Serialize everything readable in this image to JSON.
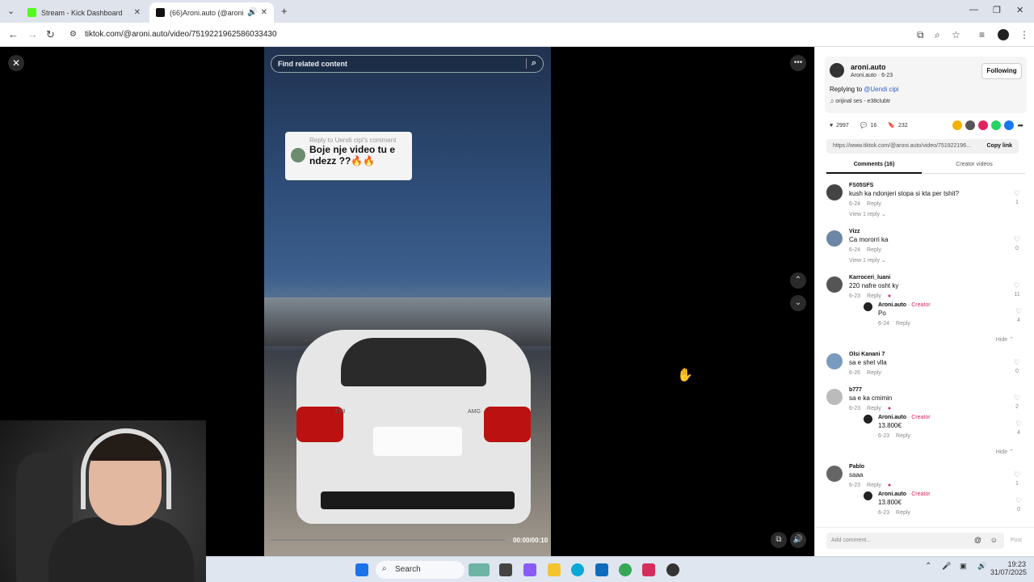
{
  "browser": {
    "tabs": [
      {
        "title": "Stream - Kick Dashboard",
        "favicon_color": "#53fc18"
      },
      {
        "title": "(66)Aroni.auto (@aroni.auto",
        "favicon_color": "#111111"
      }
    ],
    "url": "tiktok.com/@aroni.auto/video/7519221962586033430"
  },
  "video": {
    "search_placeholder": "Find related content",
    "reply_bubble": {
      "header": "Reply to Uendi cipi's comment",
      "text": "Boje nje video tu e ndezz ??🔥🔥"
    },
    "time": "00:00/00:10",
    "progress": 0.0,
    "close_icon": "✕",
    "more_icon": "•••"
  },
  "author": {
    "handle": "aroni.auto",
    "name_date": "Aroni.auto · 6-23",
    "follow_label": "Following",
    "replying_prefix": "Replying to",
    "replying_to": "@Uendi cipi",
    "sound": "orijinal ses - e38clubtr"
  },
  "stats": {
    "likes": "2997",
    "comments": "16",
    "saves": "232"
  },
  "share": {
    "url": "https://www.tiktok.com/@aroni.auto/video/751922196...",
    "copy_label": "Copy link"
  },
  "tabs": {
    "comments": "Comments (16)",
    "creator": "Creator videos"
  },
  "comments": [
    {
      "user": "FS05SFS",
      "text": "kush ka ndonjeri stopa si kta per tshit?",
      "date": "6-24",
      "reply": "Reply",
      "likes": "1",
      "view": "View 1 reply ⌄"
    },
    {
      "user": "Vizz",
      "text": "Ca mororri ka",
      "date": "6-24",
      "reply": "Reply",
      "likes": "0",
      "view": "View 1 reply ⌄"
    },
    {
      "user": "Karroceri_luani",
      "text": "220 nafre osht ky",
      "date": "6-23",
      "reply": "Reply",
      "likes": "11",
      "sub": {
        "user": "Aroni.auto",
        "tag": " · Creator",
        "text": "Po",
        "date": "6-24",
        "reply": "Reply",
        "likes": "4"
      },
      "hide": "Hide ⌃"
    },
    {
      "user": "Olsi Kanani 7",
      "text": "sa e shet vlla",
      "date": "6-26",
      "reply": "Reply",
      "likes": "0"
    },
    {
      "user": "b777",
      "text": "sa e ka cmimin",
      "date": "6-23",
      "reply": "Reply",
      "likes": "2",
      "sub": {
        "user": "Aroni.auto",
        "tag": " · Creator",
        "text": "13.800€",
        "date": "6-23",
        "reply": "Reply",
        "likes": "4"
      },
      "hide": "Hide ⌃"
    },
    {
      "user": "Pablo",
      "text": "saaa",
      "date": "6-23",
      "reply": "Reply",
      "likes": "1",
      "sub": {
        "user": "Aroni.auto",
        "tag": " · Creator",
        "text": "13.800€",
        "date": "6-23",
        "reply": "Reply",
        "likes": "0"
      }
    }
  ],
  "add_comment": {
    "placeholder": "Add comment...",
    "post": "Post"
  },
  "taskbar": {
    "search": "Search",
    "time": "19:23",
    "date": "31/07/2025"
  },
  "car": {
    "badge_left": "E63",
    "badge_right": "AMG"
  }
}
